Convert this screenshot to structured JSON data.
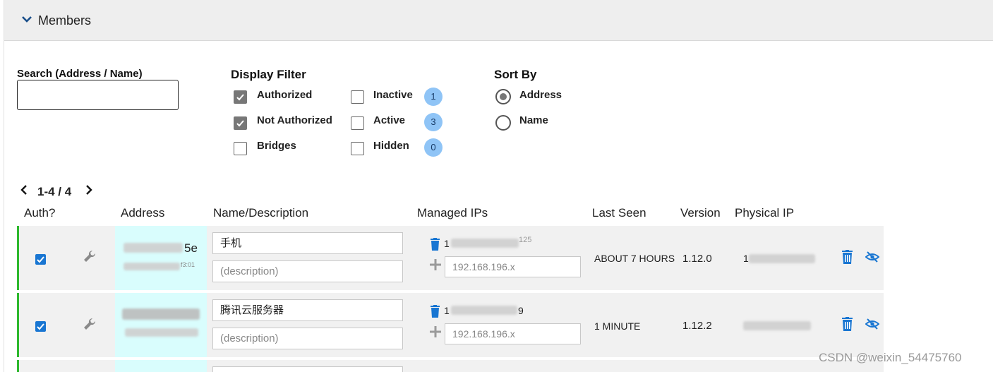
{
  "section": {
    "title": "Members"
  },
  "search": {
    "label": "Search (Address / Name)",
    "value": ""
  },
  "display_filter": {
    "title": "Display Filter",
    "authorized": {
      "label": "Authorized",
      "checked": true
    },
    "not_authorized": {
      "label": "Not Authorized",
      "checked": true
    },
    "bridges": {
      "label": "Bridges",
      "checked": false
    },
    "inactive": {
      "label": "Inactive",
      "checked": false,
      "count": "1"
    },
    "active": {
      "label": "Active",
      "checked": false,
      "count": "3"
    },
    "hidden": {
      "label": "Hidden",
      "checked": false,
      "count": "0"
    }
  },
  "sort_by": {
    "title": "Sort By",
    "address": {
      "label": "Address",
      "selected": true
    },
    "name": {
      "label": "Name",
      "selected": false
    }
  },
  "pager": {
    "range": "1-4 / 4"
  },
  "columns": {
    "auth": "Auth?",
    "address": "Address",
    "name": "Name/Description",
    "managed_ips": "Managed IPs",
    "last_seen": "Last Seen",
    "version": "Version",
    "physical_ip": "Physical IP"
  },
  "rows": [
    {
      "authorized": true,
      "address_visible": "5e",
      "address_sub_visible": "f3:01",
      "name": "手机",
      "description_placeholder": "(description)",
      "managed_ip_visible_start": "1",
      "managed_ip_visible_end": "125",
      "ip_placeholder": "192.168.196.x",
      "last_seen": "ABOUT 7 HOURS",
      "version": "1.12.0",
      "physical_ip_visible": "1"
    },
    {
      "authorized": true,
      "address_visible": "",
      "address_sub_visible": "",
      "name": "腾讯云服务器",
      "description_placeholder": "(description)",
      "managed_ip_visible_start": "1",
      "managed_ip_visible_end": "9",
      "ip_placeholder": "192.168.196.x",
      "last_seen": "1 MINUTE",
      "version": "1.12.2",
      "physical_ip_visible": ""
    }
  ],
  "watermark": "CSDN @weixin_54475760",
  "colors": {
    "accent": "#1976d2",
    "authorized_bar": "#2eb82e",
    "address_bg": "#d9fdfd",
    "badge": "#8fc4f6"
  }
}
